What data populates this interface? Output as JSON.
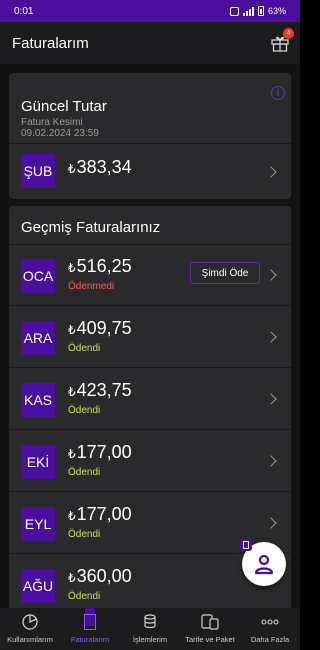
{
  "status_bar": {
    "time": "0:01",
    "battery": "63%"
  },
  "header": {
    "title": "Faturalarım",
    "gift_badge": "4"
  },
  "current_bill": {
    "title": "Güncel Tutar",
    "cut_label": "Fatura Kesimi",
    "cut_date": "09.02.2024 23:59",
    "month": "ŞUB",
    "currency": "₺",
    "amount": "383,34"
  },
  "past_bills": {
    "title": "Geçmiş Faturalarınız",
    "pay_now_label": "Şimdi Öde",
    "items": [
      {
        "month": "OCA",
        "currency": "₺",
        "amount": "516,25",
        "status": "Ödenmedi"
      },
      {
        "month": "ARA",
        "currency": "₺",
        "amount": "409,75",
        "status": "Ödendi"
      },
      {
        "month": "KAS",
        "currency": "₺",
        "amount": "423,75",
        "status": "Ödendi"
      },
      {
        "month": "EKİ",
        "currency": "₺",
        "amount": "177,00",
        "status": "Ödendi"
      },
      {
        "month": "EYL",
        "currency": "₺",
        "amount": "177,00",
        "status": "Ödendi"
      },
      {
        "month": "AĞU",
        "currency": "₺",
        "amount": "360,00",
        "status": "Ödendi"
      }
    ]
  },
  "bottom_nav": [
    {
      "label": "Kullanımlarım",
      "icon": "pie-chart-icon"
    },
    {
      "label": "Faturalarım",
      "icon": "bill-icon"
    },
    {
      "label": "İşlemlerim",
      "icon": "coins-icon"
    },
    {
      "label": "Tarife ve Paket",
      "icon": "devices-icon"
    },
    {
      "label": "Daha Fazla",
      "icon": "more-dots-icon"
    }
  ],
  "colors": {
    "brand": "#4a0f9e",
    "paid": "#d4e05a",
    "unpaid": "#ff5a4e"
  }
}
